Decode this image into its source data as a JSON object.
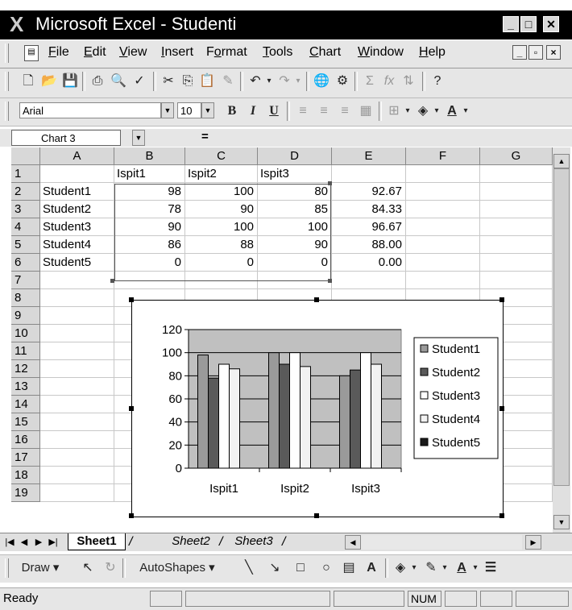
{
  "window": {
    "title": "Microsoft Excel - Studenti",
    "app_icon": "excel-icon"
  },
  "menu": {
    "items": [
      {
        "label": "File",
        "accel": "F"
      },
      {
        "label": "Edit",
        "accel": "E"
      },
      {
        "label": "View",
        "accel": "V"
      },
      {
        "label": "Insert",
        "accel": "I"
      },
      {
        "label": "Format",
        "accel": "o"
      },
      {
        "label": "Tools",
        "accel": "T"
      },
      {
        "label": "Chart",
        "accel": "C"
      },
      {
        "label": "Window",
        "accel": "W"
      },
      {
        "label": "Help",
        "accel": "H"
      }
    ]
  },
  "format_bar": {
    "font": "Arial",
    "size": "10",
    "bold": "B",
    "italic": "I",
    "underline": "U"
  },
  "formula_bar": {
    "name_box": "Chart 3",
    "equals": "="
  },
  "columns": [
    "A",
    "B",
    "C",
    "D",
    "E",
    "F",
    "G"
  ],
  "rows": [
    "1",
    "2",
    "3",
    "4",
    "5",
    "6",
    "7",
    "8",
    "9",
    "10",
    "11",
    "12",
    "13",
    "14",
    "15",
    "16",
    "17",
    "18",
    "19"
  ],
  "sheet": {
    "headers": [
      "Ispit1",
      "Ispit2",
      "Ispit3"
    ],
    "students": [
      {
        "name": "Student1",
        "scores": [
          "98",
          "100",
          "80"
        ],
        "avg": "92.67"
      },
      {
        "name": "Student2",
        "scores": [
          "78",
          "90",
          "85"
        ],
        "avg": "84.33"
      },
      {
        "name": "Student3",
        "scores": [
          "90",
          "100",
          "100"
        ],
        "avg": "96.67"
      },
      {
        "name": "Student4",
        "scores": [
          "86",
          "88",
          "90"
        ],
        "avg": "88.00"
      },
      {
        "name": "Student5",
        "scores": [
          "0",
          "0",
          "0"
        ],
        "avg": "0.00"
      }
    ]
  },
  "chart_data": {
    "type": "bar",
    "categories": [
      "Ispit1",
      "Ispit2",
      "Ispit3"
    ],
    "series": [
      {
        "name": "Student1",
        "values": [
          98,
          100,
          80
        ],
        "color": "#9a9a9a"
      },
      {
        "name": "Student2",
        "values": [
          78,
          90,
          85
        ],
        "color": "#5a5a5a"
      },
      {
        "name": "Student3",
        "values": [
          90,
          100,
          100
        ],
        "color": "#ffffff"
      },
      {
        "name": "Student4",
        "values": [
          86,
          88,
          90
        ],
        "color": "#f2f2f2"
      },
      {
        "name": "Student5",
        "values": [
          0,
          0,
          0
        ],
        "color": "#1a1a1a"
      }
    ],
    "yticks": [
      "0",
      "20",
      "40",
      "60",
      "80",
      "100",
      "120"
    ],
    "ylim": [
      0,
      120
    ],
    "grid": true,
    "legend": "right",
    "plot_bg": "#c0c0c0"
  },
  "sheet_tabs": [
    "Sheet1",
    "Sheet2",
    "Sheet3"
  ],
  "drawing": {
    "draw": "Draw",
    "autoshapes": "AutoShapes"
  },
  "status": {
    "text": "Ready",
    "num": "NUM"
  }
}
